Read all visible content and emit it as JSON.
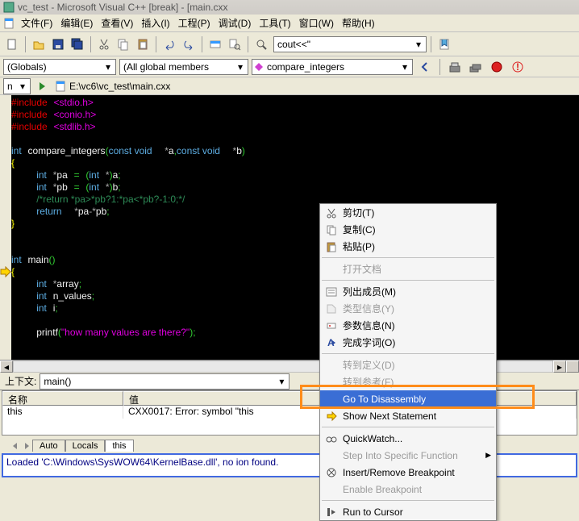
{
  "title": "vc_test - Microsoft Visual C++ [break] - [main.cxx",
  "menu": [
    "文件(F)",
    "编辑(E)",
    "查看(V)",
    "插入(I)",
    "工程(P)",
    "调试(D)",
    "工具(T)",
    "窗口(W)",
    "帮助(H)"
  ],
  "combo_find": "cout<<\"",
  "scope1": "(Globals)",
  "scope2": "(All global members",
  "scope3": "compare_integers",
  "path_nav": "n",
  "path": "E:\\vc6\\vc_test\\main.cxx",
  "gutter_arrow_line": 15,
  "code_html": "<span class='kw-pre'>#include</span> <span class='kw-inc'>&lt;stdio.h&gt;</span>\n<span class='kw-pre'>#include</span> <span class='kw-inc'>&lt;conio.h&gt;</span>\n<span class='kw-pre'>#include</span> <span class='kw-inc'>&lt;stdlib.h&gt;</span>\n\n<span class='kw-blue'>int</span> <span class='kw-name'>compare_integers</span><span class='kw-paren'>(</span><span class='kw-blue'>const void</span>  <span class='kw-star'>*</span><span class='kw-name'>a</span><span class='kw-punc'>,</span><span class='kw-blue'>const void</span>  <span class='kw-star'>*</span><span class='kw-name'>b</span><span class='kw-paren'>)</span>\n<span class='kw-yellow'>{</span>\n    <span class='kw-blue'>int</span> <span class='kw-star'>*</span><span class='kw-name'>pa</span> <span class='kw-punc'>=</span> <span class='kw-paren'>(</span><span class='kw-blue'>int</span> <span class='kw-star'>*</span><span class='kw-paren'>)</span><span class='kw-name'>a</span><span class='kw-punc'>;</span>\n    <span class='kw-blue'>int</span> <span class='kw-star'>*</span><span class='kw-name'>pb</span> <span class='kw-punc'>=</span> <span class='kw-paren'>(</span><span class='kw-blue'>int</span> <span class='kw-star'>*</span><span class='kw-paren'>)</span><span class='kw-name'>b</span><span class='kw-punc'>;</span>\n    <span class='kw-cmt'>/*return *pa&gt;*pb?1:*pa&lt;*pb?-1:0;*/</span>\n    <span class='kw-blue'>return</span>  <span class='kw-star'>*</span><span class='kw-name'>pa</span><span class='kw-star'>-*</span><span class='kw-name'>pb</span><span class='kw-punc'>;</span>\n<span class='kw-yellow'>}</span>\n\n\n<span class='kw-blue'>int</span> <span class='kw-name'>main</span><span class='kw-paren'>()</span>\n<span class='kw-yellow'>{</span>\n    <span class='kw-blue'>int</span> <span class='kw-star'>*</span><span class='kw-name'>array</span><span class='kw-punc'>;</span>\n    <span class='kw-blue'>int</span> <span class='kw-name'>n_values</span><span class='kw-punc'>;</span>\n    <span class='kw-blue'>int</span> <span class='kw-name'>i</span><span class='kw-punc'>;</span>\n\n    <span class='kw-name'>printf</span><span class='kw-paren'>(</span><span class='kw-str'>\"how many values are there?\"</span><span class='kw-paren'>)</span><span class='kw-punc'>;</span>",
  "watch": {
    "context_label": "上下文:",
    "context_value": "main()",
    "col_name": "名称",
    "col_value": "值",
    "row_name": "this",
    "row_value": "CXX0017: Error: symbol \"this",
    "tabs": [
      "Auto",
      "Locals",
      "this"
    ]
  },
  "output": "Loaded 'C:\\Windows\\SysWOW64\\KernelBase.dll', no                         ion found.",
  "ctx": {
    "cut": "剪切(T)",
    "copy": "复制(C)",
    "paste": "粘贴(P)",
    "opendoc": "打开文档",
    "listmembers": "列出成员(M)",
    "typeinfo": "类型信息(Y)",
    "paraminfo": "参数信息(N)",
    "complete": "完成字词(O)",
    "gotodef": "转到定义(D)",
    "gotoref": "转到参考(F)",
    "gotodisasm": "Go To Disassembly",
    "shownext": "Show Next Statement",
    "quickwatch": "QuickWatch...",
    "stepinto": "Step Into Specific Function",
    "insrembreak": "Insert/Remove Breakpoint",
    "enablebreak": "Enable Breakpoint",
    "runtocursor": "Run to Cursor"
  }
}
